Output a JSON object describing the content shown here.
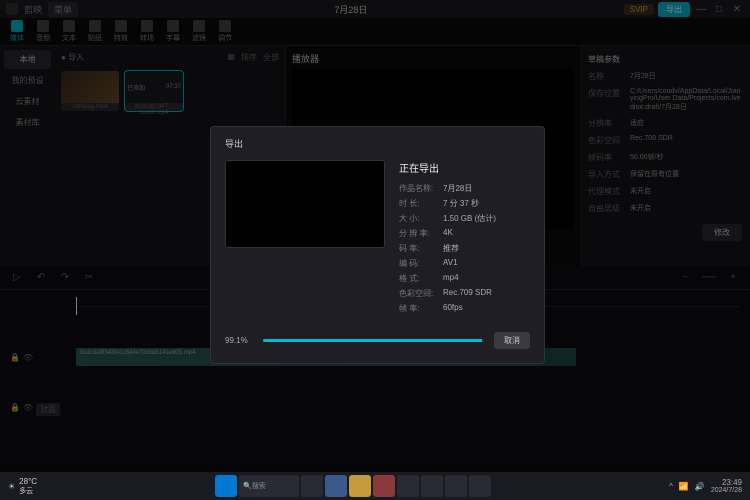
{
  "titlebar": {
    "app": "剪映",
    "menu": "菜单",
    "project_name": "7月28日",
    "svip": "SVIP",
    "export": "导出"
  },
  "toolbar": {
    "items": [
      "媒体",
      "音频",
      "文本",
      "贴纸",
      "特效",
      "转场",
      "字幕",
      "滤镜",
      "调节"
    ]
  },
  "sidebar": {
    "items": [
      "本地",
      "我的预设",
      "云素材",
      "素材库"
    ]
  },
  "media": {
    "import": "导入",
    "sort": "排序",
    "all": "全部",
    "clip1": "compog.mp4",
    "clip2": "已添加",
    "clip2_dur": "07:37",
    "clip2_name": "8cdc3d1347... 1xx80.mp4"
  },
  "preview": {
    "title": "播放器"
  },
  "props": {
    "title": "草稿参数",
    "rows": [
      {
        "label": "名称",
        "value": "7月28日"
      },
      {
        "label": "保存位置",
        "value": "C:/Users/coudv/AppData/Local/JianyingPro/User Data/Projects/com.lveditor.draft/7月28日"
      },
      {
        "label": "分辨率",
        "value": "适应"
      },
      {
        "label": "色彩空间",
        "value": "Rec.709 SDR"
      },
      {
        "label": "帧码率",
        "value": "50.00帧/秒"
      },
      {
        "label": "导入方式",
        "value": "保留在原有位置"
      },
      {
        "label": "代理模式",
        "value": "未开启"
      },
      {
        "label": "自由层级",
        "value": "未开启"
      }
    ],
    "modify": "修改"
  },
  "timeline": {
    "clip_name": "8cdc3a9f343f4116d4e70cbb8141ed05.mp4",
    "cover": "封面"
  },
  "export_modal": {
    "header": "导出",
    "title": "正在导出",
    "rows": [
      {
        "label": "作品名称:",
        "value": "7月28日"
      },
      {
        "label": "时    长:",
        "value": "7 分 37 秒"
      },
      {
        "label": "大    小:",
        "value": "1.50 GB  (估计)"
      },
      {
        "label": "分 辨 率:",
        "value": "4K"
      },
      {
        "label": "码    率:",
        "value": "推荐"
      },
      {
        "label": "编    码:",
        "value": "AV1"
      },
      {
        "label": "格    式:",
        "value": "mp4"
      },
      {
        "label": "色彩空间:",
        "value": "Rec.709 SDR"
      },
      {
        "label": "帧    率:",
        "value": "60fps"
      }
    ],
    "progress": "99.1%",
    "cancel": "取消"
  },
  "taskbar": {
    "temp": "28°C",
    "weather": "多云",
    "search": "搜索",
    "time": "23:49",
    "date": "2024/7/28"
  }
}
